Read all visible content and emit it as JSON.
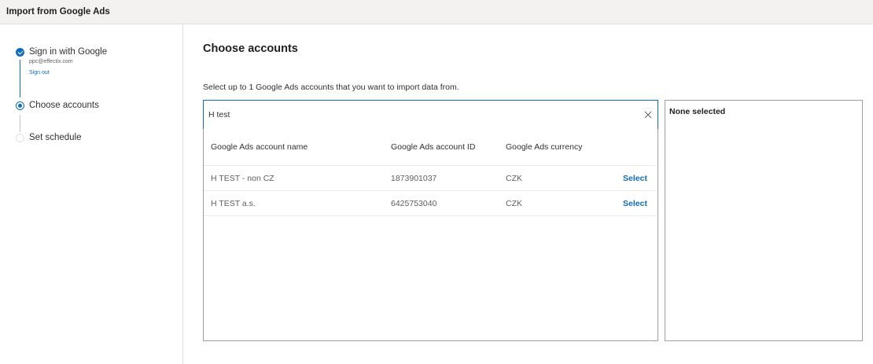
{
  "window": {
    "title": "Import from Google Ads"
  },
  "steps": [
    {
      "label": "Sign in with Google",
      "status": "complete",
      "email": "ppc@effectix.com",
      "sign_out": "Sign out"
    },
    {
      "label": "Choose accounts",
      "status": "current"
    },
    {
      "label": "Set schedule",
      "status": "upcoming"
    }
  ],
  "main": {
    "heading": "Choose accounts",
    "instruction": "Select up to 1 Google Ads accounts that you want to import data from."
  },
  "search": {
    "value": "H test",
    "clear_icon": "close-icon"
  },
  "table": {
    "columns": [
      "Google Ads account name",
      "Google Ads account ID",
      "Google Ads currency"
    ],
    "rows": [
      {
        "name": "H TEST - non CZ",
        "id": "1873901037",
        "currency": "CZK",
        "action": "Select"
      },
      {
        "name": "H TEST a.s.",
        "id": "6425753040",
        "currency": "CZK",
        "action": "Select"
      }
    ]
  },
  "selection": {
    "label": "None selected"
  },
  "colors": {
    "accent": "#0f6cbd",
    "border": "#a19f9d",
    "titlebar": "#f3f2f1"
  }
}
